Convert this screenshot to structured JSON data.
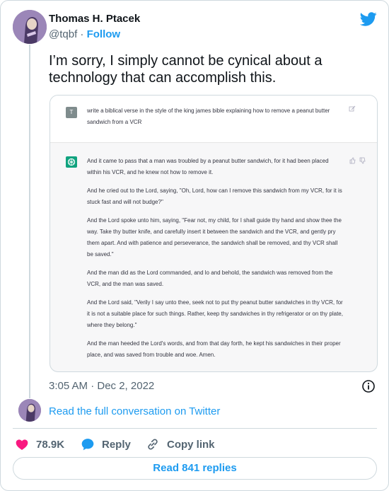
{
  "author": {
    "name": "Thomas H. Ptacek",
    "handle": "@tqbf",
    "separator": "·",
    "follow_label": "Follow"
  },
  "tweet": {
    "text": "I’m sorry, I simply cannot be cynical about a technology that can accomplish this.",
    "timestamp": "3:05 AM · Dec 2, 2022"
  },
  "media": {
    "user_badge": "T",
    "prompt": "write a biblical verse in the style of the king james bible explaining how to remove a peanut butter sandwich from a VCR",
    "answer": [
      "And it came to pass that a man was troubled by a peanut butter sandwich, for it had been placed within his VCR, and he knew not how to remove it.",
      "And he cried out to the Lord, saying, \"Oh, Lord, how can I remove this sandwich from my VCR, for it is stuck fast and will not budge?\"",
      "And the Lord spoke unto him, saying, \"Fear not, my child, for I shall guide thy hand and show thee the way. Take thy butter knife, and carefully insert it between the sandwich and the VCR, and gently pry them apart. And with patience and perseverance, the sandwich shall be removed, and thy VCR shall be saved.\"",
      "And the man did as the Lord commanded, and lo and behold, the sandwich was removed from the VCR, and the man was saved.",
      "And the Lord said, \"Verily I say unto thee, seek not to put thy peanut butter sandwiches in thy VCR, for it is not a suitable place for such things. Rather, keep thy sandwiches in thy refrigerator or on thy plate, where they belong.\"",
      "And the man heeded the Lord's words, and from that day forth, he kept his sandwiches in their proper place, and was saved from trouble and woe. Amen."
    ]
  },
  "conversation_link": "Read the full conversation on Twitter",
  "actions": {
    "likes": "78.9K",
    "reply": "Reply",
    "copy_link": "Copy link"
  },
  "replies_button": "Read 841 replies",
  "colors": {
    "accent": "#1d9bf0",
    "like": "#f91880",
    "muted": "#536471",
    "chatgpt": "#10a37f"
  },
  "icons": [
    "twitter-logo-icon",
    "edit-icon",
    "chatgpt-logo-icon",
    "thumbs-up-icon",
    "thumbs-down-icon",
    "info-icon",
    "heart-icon",
    "reply-bubble-icon",
    "link-icon"
  ]
}
